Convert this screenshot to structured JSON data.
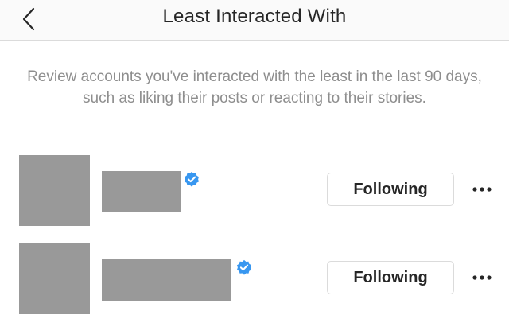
{
  "header": {
    "title": "Least Interacted With",
    "back_icon": "chevron-left-icon"
  },
  "description": "Review accounts you've interacted with the least in the last 90 days, such as liking their posts or reacting to their stories.",
  "accounts": [
    {
      "verified": true,
      "button_label": "Following"
    },
    {
      "verified": true,
      "button_label": "Following"
    }
  ],
  "colors": {
    "verified_badge": "#3897f0",
    "redaction": "#999999",
    "secondary_text": "#8e8e8e"
  }
}
